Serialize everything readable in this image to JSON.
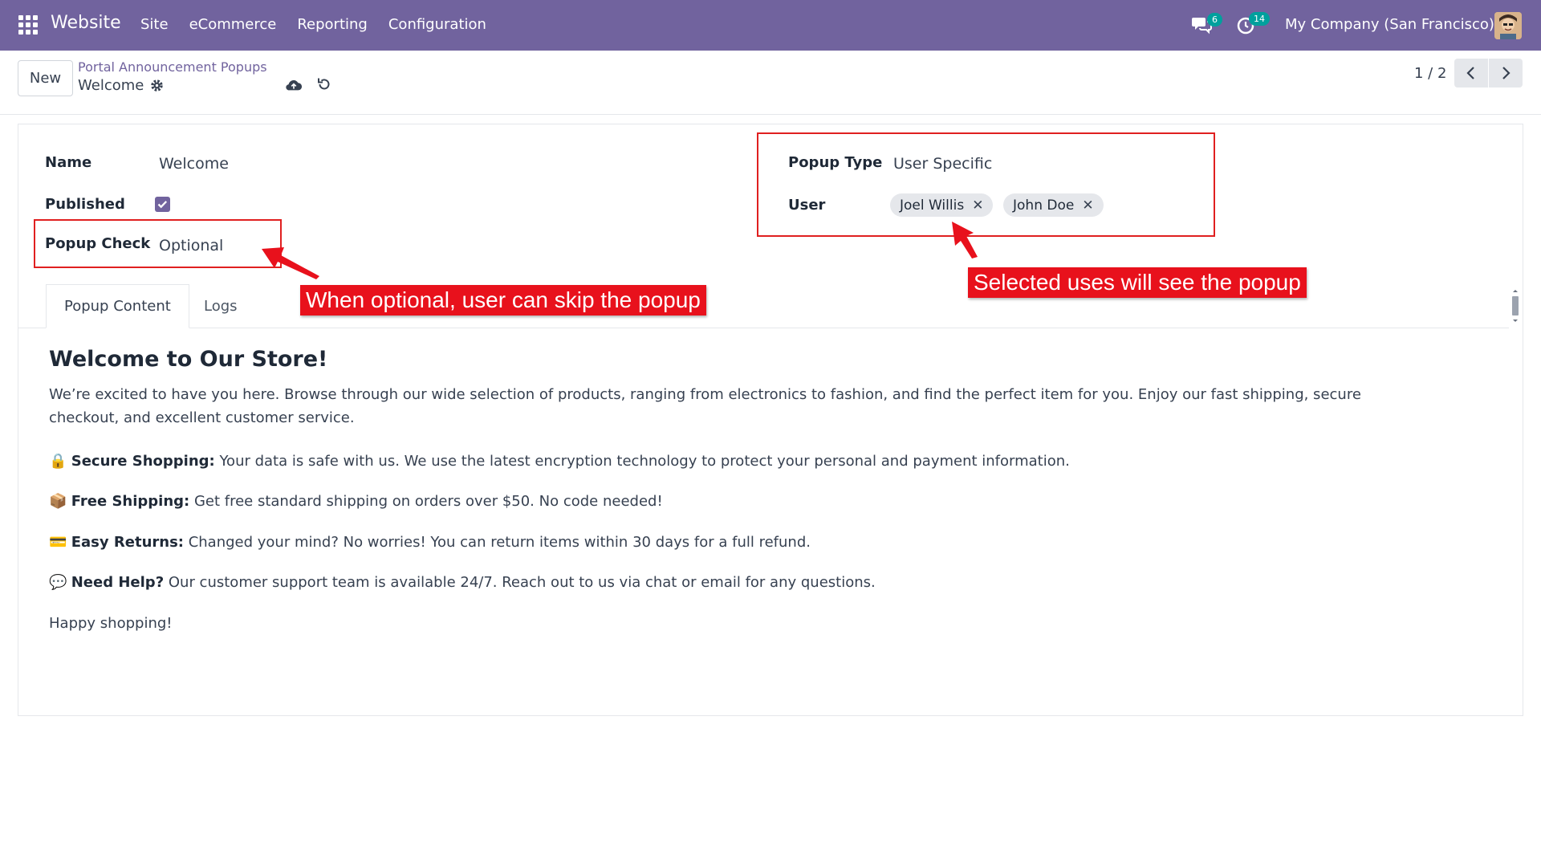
{
  "navbar": {
    "app_name": "Website",
    "menu": [
      "Site",
      "eCommerce",
      "Reporting",
      "Configuration"
    ],
    "messages_count": "6",
    "activities_count": "14",
    "company": "My Company (San Francisco)",
    "accent_color": "#71639e"
  },
  "control_panel": {
    "new_label": "New",
    "breadcrumb": "Portal Announcement Popups",
    "record_title": "Welcome",
    "pager": "1 / 2"
  },
  "form": {
    "name_label": "Name",
    "name_value": "Welcome",
    "published_label": "Published",
    "published": true,
    "popup_check_label": "Popup Check",
    "popup_check_value": "Optional",
    "popup_type_label": "Popup Type",
    "popup_type_value": "User Specific",
    "user_label": "User",
    "users": [
      "Joel Willis",
      "John Doe"
    ]
  },
  "annotations": {
    "optional_note": "When optional, user can skip the popup",
    "users_note": "Selected uses will see the popup",
    "color": "#e8111c"
  },
  "tabs": [
    "Popup Content",
    "Logs"
  ],
  "content": {
    "heading": "Welcome to Our Store!",
    "intro": "We’re excited to have you here. Browse through our wide selection of products, ranging from electronics to fashion, and find the perfect item for you. Enjoy our fast shipping, secure checkout, and excellent customer service.",
    "items": [
      {
        "icon": "lock",
        "title": "Secure Shopping:",
        "text": " Your data is safe with us. We use the latest encryption technology to protect your personal and payment information."
      },
      {
        "icon": "package",
        "title": "Free Shipping:",
        "text": " Get free standard shipping on orders over $50. No code needed!"
      },
      {
        "icon": "credit-card",
        "title": "Easy Returns:",
        "text": " Changed your mind? No worries! You can return items within 30 days for a full refund."
      },
      {
        "icon": "speech-bubble",
        "title": "Need Help?",
        "text": " Our customer support team is available 24/7. Reach out to us via chat or email for any questions."
      }
    ],
    "closing": "Happy shopping!"
  }
}
